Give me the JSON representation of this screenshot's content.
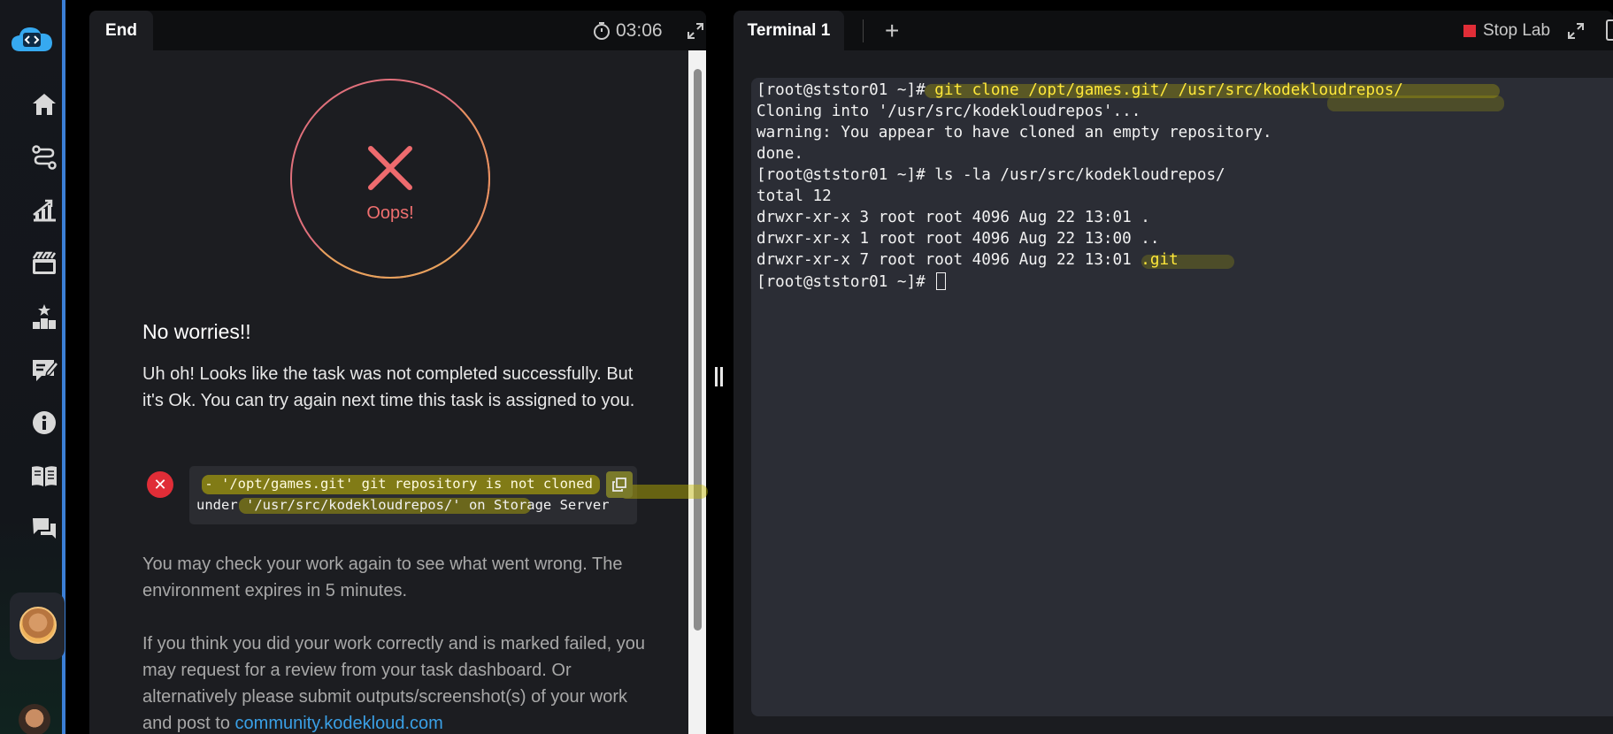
{
  "sidebar": {
    "nav": [
      "home-icon",
      "roadmap-icon",
      "progress-icon",
      "courses-icon",
      "leaderboard-icon",
      "notes-icon",
      "info-icon",
      "docs-icon",
      "chat-icon"
    ]
  },
  "left": {
    "tab_label": "End",
    "timer": "03:06",
    "result_text": "Oops!",
    "heading": "No worries!!",
    "message": "Uh oh! Looks like the task was not completed successfully. But it's Ok. You can try again next time this task is assigned to you.",
    "error_line1": " - '/opt/games.git' git repository is not cloned",
    "error_line2": "under '/usr/src/kodekloudrepos/' on Storage Server",
    "check_text": "You may check your work again to see what went wrong. The environment expires in 5 minutes.",
    "review_text": "If you think you did your work correctly and is marked failed, you may request for a review from your task dashboard. Or alternatively please submit outputs/screenshot(s) of your work and post to ",
    "link_text": "community.kodekloud.com"
  },
  "right": {
    "tab_label": "Terminal 1",
    "add_tab": "+",
    "stop_label": "Stop Lab",
    "terminal": {
      "prompt": "[root@ststor01 ~]#",
      "cmd1": " git clone /opt/games.git/ /usr/src/kodekloudrepos/",
      "out1": "Cloning into '/usr/src/kodekloudrepos'...",
      "out2": "warning: You appear to have cloned an empty repository.",
      "out3": "done.",
      "cmd2": " ls -la /usr/src/kodekloudrepos/",
      "out4": "total 12",
      "out5": "drwxr-xr-x 3 root root 4096 Aug 22 13:01 .",
      "out6": "drwxr-xr-x 1 root root 4096 Aug 22 13:00 ..",
      "out7": "drwxr-xr-x 7 root root 4096 Aug 22 13:01",
      "out7_name": " .git",
      "final_prompt": "[root@ststor01 ~]# "
    }
  },
  "colors": {
    "accent_blue": "#3aa0e6",
    "error_red": "#e02d37",
    "terminal_highlight": "#ffe83a"
  }
}
